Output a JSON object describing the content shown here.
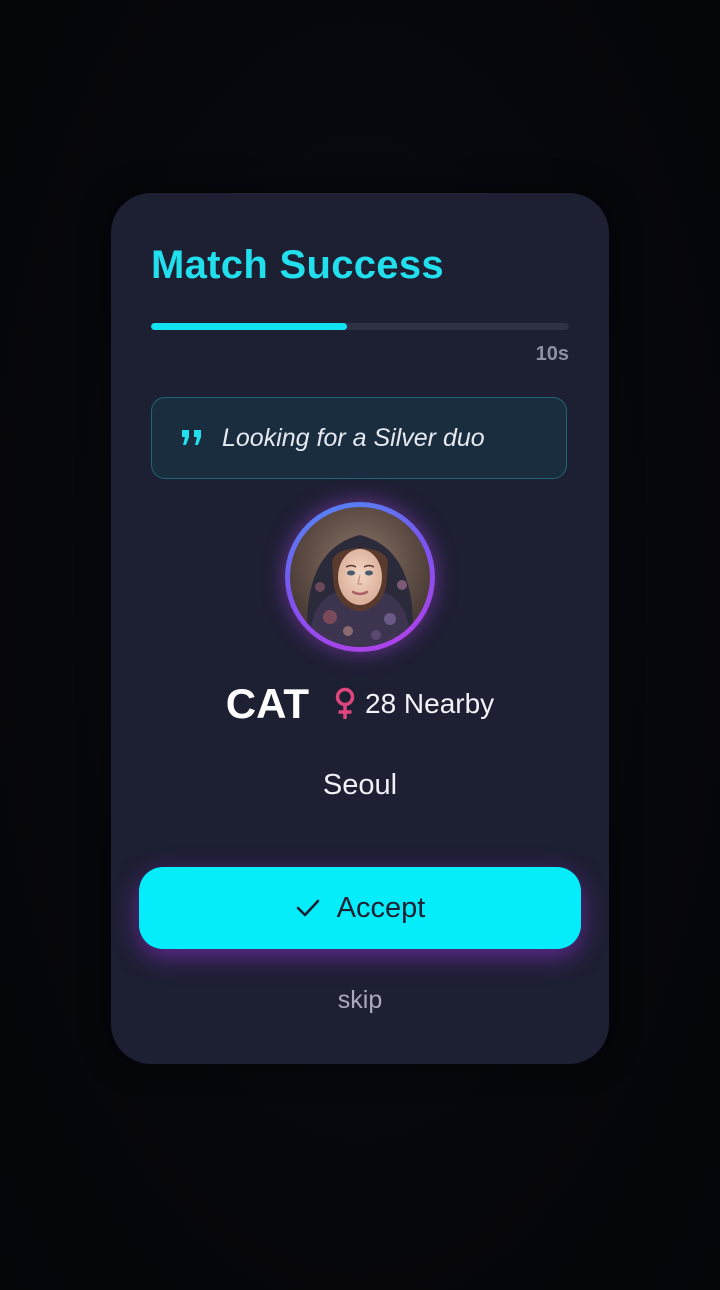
{
  "dialog": {
    "title": "Match Success",
    "countdown": {
      "label": "10s",
      "progress_fraction": 0.47
    },
    "quote": {
      "icon": "quote-icon",
      "text": "Looking for a Silver duo"
    },
    "profile": {
      "avatar_icon": "avatar-photo",
      "name": "CAT",
      "gender_icon": "female-symbol-icon",
      "details": "28 Nearby",
      "city": "Seoul"
    },
    "accept_button": {
      "icon": "check-icon",
      "label": "Accept"
    },
    "skip_label": "skip"
  },
  "colors": {
    "background": "#06070c",
    "card": "#1d1f33",
    "accent": "#12e3f2",
    "button": "#05edfb",
    "gender": "#e0457e",
    "ring_start": "#4d8cf5",
    "ring_end": "#b93de8"
  }
}
